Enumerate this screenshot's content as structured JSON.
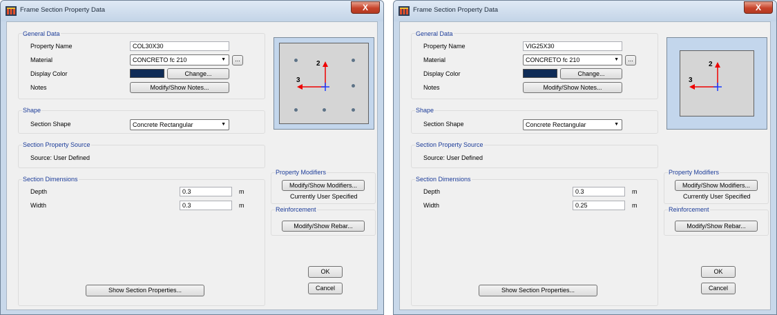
{
  "window_title": "Frame Section Property Data",
  "close_glyph": "X",
  "labels": {
    "general_data": "General Data",
    "property_name": "Property Name",
    "material": "Material",
    "display_color": "Display Color",
    "notes": "Notes",
    "shape": "Shape",
    "section_shape": "Section Shape",
    "section_property_source": "Section Property Source",
    "source": "Source:  User Defined",
    "section_dimensions": "Section Dimensions",
    "depth": "Depth",
    "width": "Width",
    "unit_m": "m",
    "property_modifiers": "Property Modifiers",
    "currently_user_specified": "Currently User Specified",
    "reinforcement": "Reinforcement",
    "axis_2": "2",
    "axis_3": "3"
  },
  "buttons": {
    "ellipsis": "...",
    "change": "Change...",
    "modify_notes": "Modify/Show Notes...",
    "modify_modifiers": "Modify/Show Modifiers...",
    "modify_rebar": "Modify/Show Rebar...",
    "show_props": "Show Section Properties...",
    "ok": "OK",
    "cancel": "Cancel"
  },
  "left": {
    "property_name": "COL30X30",
    "material": "CONCRETO fc 210",
    "section_shape": "Concrete Rectangular",
    "depth": "0.3",
    "width": "0.3",
    "display_color": "#0f2c57",
    "rebar_dots": true
  },
  "right": {
    "property_name": "VIG25X30",
    "material": "CONCRETO fc 210",
    "section_shape": "Concrete Rectangular",
    "depth": "0.3",
    "width": "0.25",
    "display_color": "#0f2c57",
    "rebar_dots": false
  }
}
